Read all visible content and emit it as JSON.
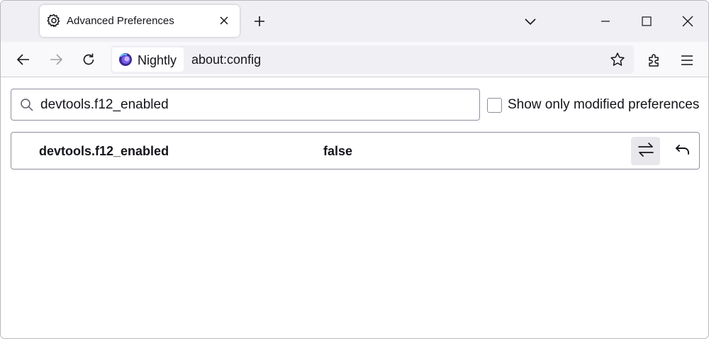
{
  "tab": {
    "title": "Advanced Preferences",
    "icon": "gear-icon"
  },
  "toolbar": {
    "brand": "Nightly",
    "url": "about:config"
  },
  "config": {
    "search_value": "devtools.f12_enabled",
    "modified_only_label": "Show only modified preferences",
    "modified_only_checked": false,
    "preferences": [
      {
        "name": "devtools.f12_enabled",
        "value": "false"
      }
    ]
  },
  "colors": {
    "tabstrip_bg": "#f0f0f4",
    "toolbar_bg": "#f9f9fb",
    "urlbar_bg": "#f0f0f4",
    "text": "#15141a",
    "border": "#8f8f9d"
  }
}
